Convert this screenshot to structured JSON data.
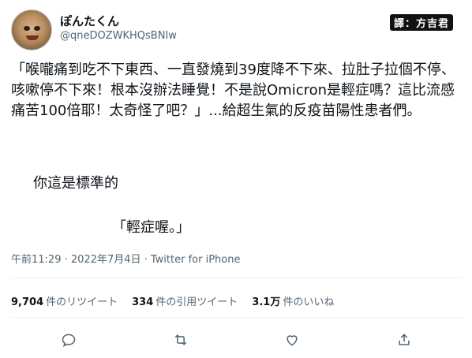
{
  "author": {
    "display_name": "ぽんたくん",
    "handle": "@qneDOZWKHQsBNIw"
  },
  "translator_badge": "譯：方吉君",
  "tweet": {
    "body": "「喉嚨痛到吃不下東西、一直發燒到39度降不下來、拉肚子拉個不停、咳嗽停不下來！根本沒辦法睡覺！不是說Omicron是輕症嗎？這比流感痛苦100倍耶！太奇怪了吧？」...給超生氣的反疫苗陽性患者們。",
    "line2": "你這是標準的",
    "line3": "「輕症喔。」"
  },
  "meta": "午前11:29 · 2022年7月4日 · Twitter for iPhone",
  "stats": {
    "retweets_count": "9,704",
    "retweets_label": "件のリツイート",
    "quotes_count": "334",
    "quotes_label": "件の引用ツイート",
    "likes_count": "3.1万",
    "likes_label": "件のいいね"
  },
  "icons": [
    "reply-icon",
    "retweet-icon",
    "like-icon",
    "share-icon"
  ],
  "colors": {
    "text": "#0f1419",
    "muted": "#536471",
    "divider": "#eff3f4"
  }
}
